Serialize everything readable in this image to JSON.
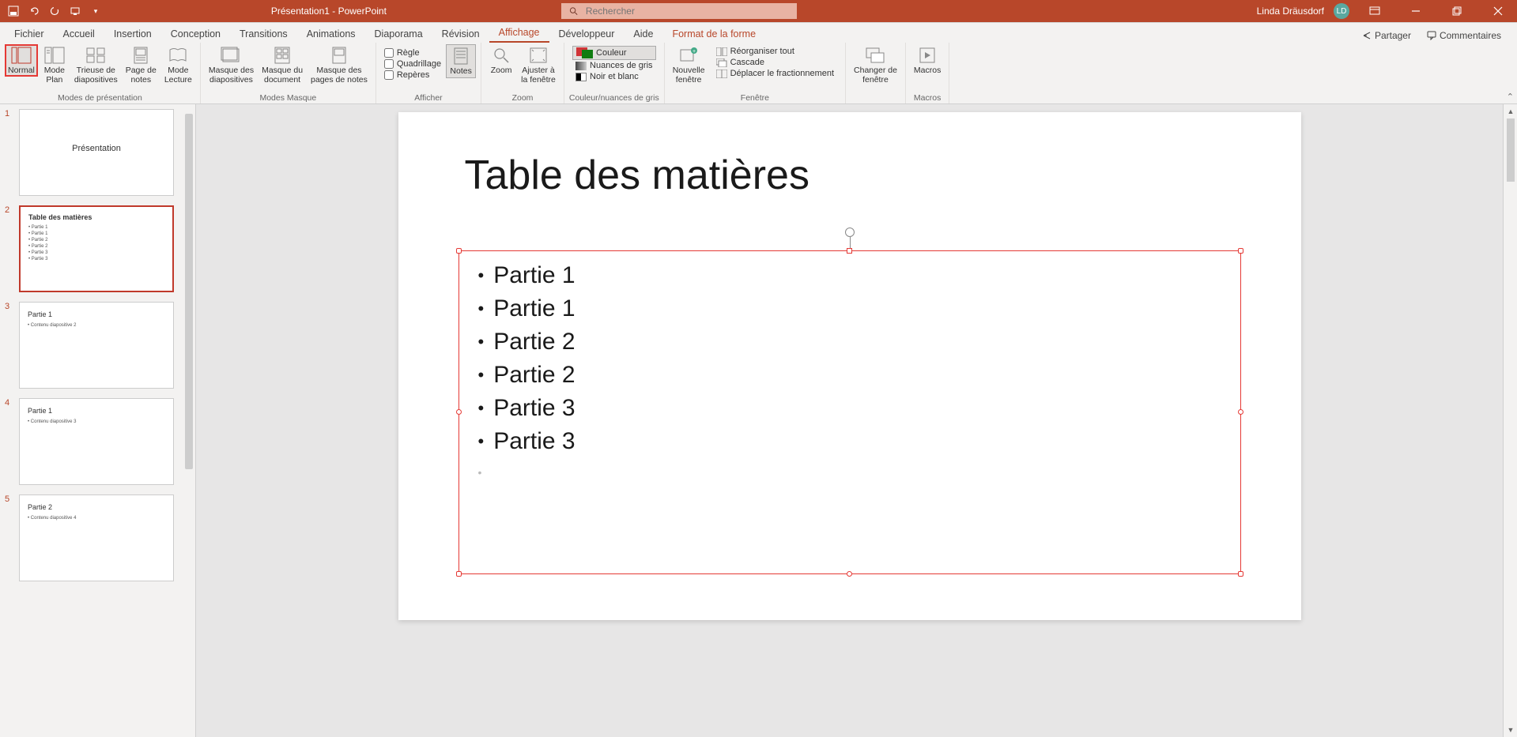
{
  "title_bar": {
    "doc_title": "Présentation1 - PowerPoint",
    "search_placeholder": "Rechercher",
    "user_name": "Linda Dräusdorf",
    "user_initials": "LD"
  },
  "tabs": {
    "items": [
      "Fichier",
      "Accueil",
      "Insertion",
      "Conception",
      "Transitions",
      "Animations",
      "Diaporama",
      "Révision",
      "Affichage",
      "Développeur",
      "Aide"
    ],
    "context_tab": "Format de la forme",
    "active": "Affichage",
    "share": "Partager",
    "comments": "Commentaires"
  },
  "ribbon": {
    "groups": {
      "modes_presentation": {
        "label": "Modes de présentation",
        "normal": "Normal",
        "mode_plan": "Mode\nPlan",
        "trieuse": "Trieuse de\ndiapositives",
        "page_notes": "Page de\nnotes",
        "mode_lecture": "Mode\nLecture"
      },
      "modes_masque": {
        "label": "Modes Masque",
        "masque_diapo": "Masque des\ndiapositives",
        "masque_doc": "Masque du\ndocument",
        "masque_notes": "Masque des\npages de notes"
      },
      "afficher": {
        "label": "Afficher",
        "regle": "Règle",
        "quadrillage": "Quadrillage",
        "reperes": "Repères",
        "notes": "Notes"
      },
      "zoom": {
        "label": "Zoom",
        "zoom": "Zoom",
        "ajuster": "Ajuster à\nla fenêtre"
      },
      "couleur": {
        "label": "Couleur/nuances de gris",
        "couleur_btn": "Couleur",
        "nuances": "Nuances de gris",
        "noir_blanc": "Noir et blanc"
      },
      "fenetre": {
        "label": "Fenêtre",
        "nouvelle": "Nouvelle\nfenêtre",
        "reorganiser": "Réorganiser tout",
        "cascade": "Cascade",
        "deplacer": "Déplacer le fractionnement"
      },
      "changer": {
        "label": "",
        "btn": "Changer de\nfenêtre"
      },
      "macros": {
        "label": "Macros",
        "btn": "Macros"
      }
    }
  },
  "thumbnails": [
    {
      "num": "1",
      "type": "title",
      "title": "Présentation"
    },
    {
      "num": "2",
      "type": "toc",
      "title": "Table des matières",
      "bullets": [
        "• Partie 1",
        "• Partie 1",
        "• Partie 2",
        "• Partie 2",
        "• Partie 3",
        "• Partie 3"
      ],
      "selected": true
    },
    {
      "num": "3",
      "type": "content",
      "title": "Partie 1",
      "sub": "• Contenu diapositive 2"
    },
    {
      "num": "4",
      "type": "content",
      "title": "Partie 1",
      "sub": "• Contenu diapositive 3"
    },
    {
      "num": "5",
      "type": "content",
      "title": "Partie 2",
      "sub": "• Contenu diapositive 4"
    }
  ],
  "slide": {
    "title": "Table des matières",
    "bullets": [
      "Partie 1",
      "Partie 1",
      "Partie 2",
      "Partie 2",
      "Partie 3",
      "Partie 3"
    ]
  }
}
